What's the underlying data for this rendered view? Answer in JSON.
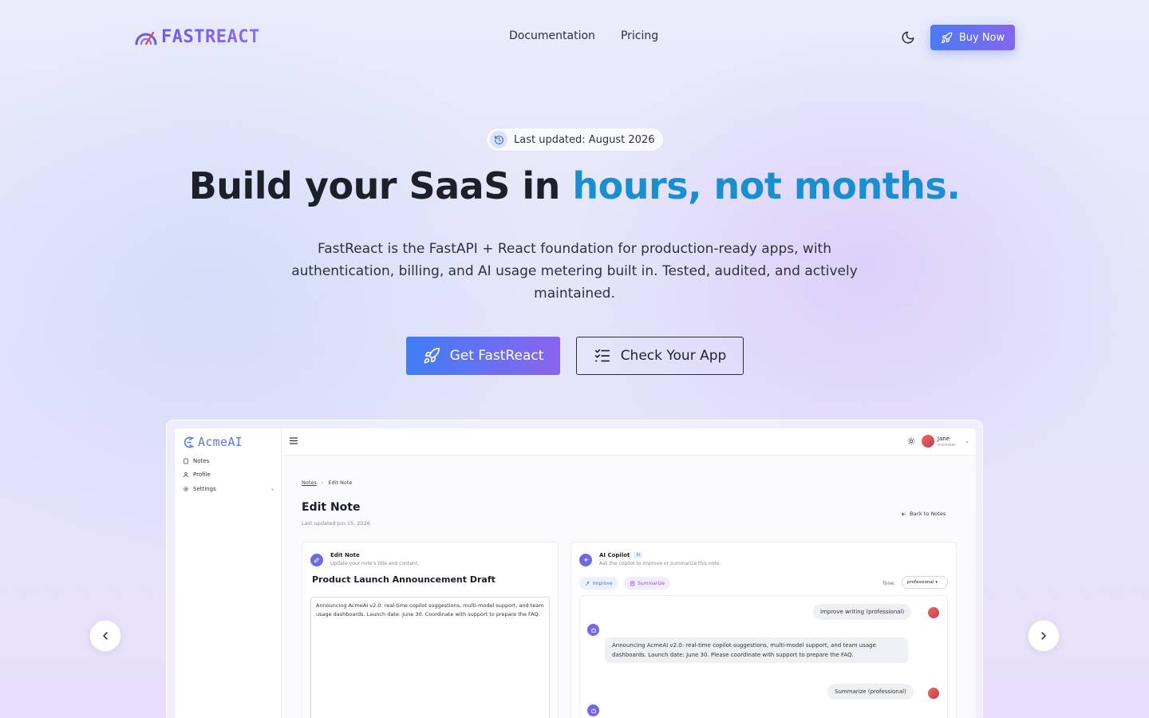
{
  "brand": {
    "name": "FASTREACT",
    "accent": "#6d5ae6"
  },
  "nav": {
    "links": [
      "Documentation",
      "Pricing"
    ],
    "buy_label": "Buy Now"
  },
  "hero": {
    "badge": "Last updated: August 2026",
    "headline_plain": "Build your SaaS in ",
    "headline_accent": "hours, not months.",
    "subtitle": "FastReact is the FastAPI + React foundation for production-ready apps, with authentication, billing, and AI usage metering built in. Tested, audited, and actively maintained.",
    "cta_primary": "Get FastReact",
    "cta_secondary": "Check Your App"
  },
  "preview": {
    "app_name": "AcmeAI",
    "sidebar": [
      "Notes",
      "Profile",
      "Settings"
    ],
    "user": {
      "name": "Jane",
      "role": "member"
    },
    "breadcrumb": [
      "Notes",
      "Edit Note"
    ],
    "page_title": "Edit Note",
    "page_meta": "Last updated Jun 15, 2026",
    "back_link": "Back to Notes",
    "editor": {
      "heading": "Edit Note",
      "description": "Update your note's title and content.",
      "note_title": "Product Launch Announcement Draft",
      "note_body": "Announcing AcmeAI v2.0: real-time copilot suggestions, multi-model support, and team usage dashboards. Launch date: June 30. Coordinate with support to prepare the FAQ."
    },
    "copilot": {
      "heading": "AI Copilot",
      "chip": "AI",
      "description": "Ask the copilot to improve or summarize this note.",
      "improve_label": "Improve",
      "summarize_label": "Summarize",
      "tone_label": "Tone:",
      "tone_value": "professional",
      "messages": {
        "user_1": "Improve writing (professional)",
        "bot_1": "Announcing AcmeAI v2.0: real-time copilot suggestions, multi-model support, and team usage dashboards. Launch date: June 30. Please coordinate with support to prepare the FAQ.",
        "user_2": "Summarize (professional)"
      }
    }
  }
}
